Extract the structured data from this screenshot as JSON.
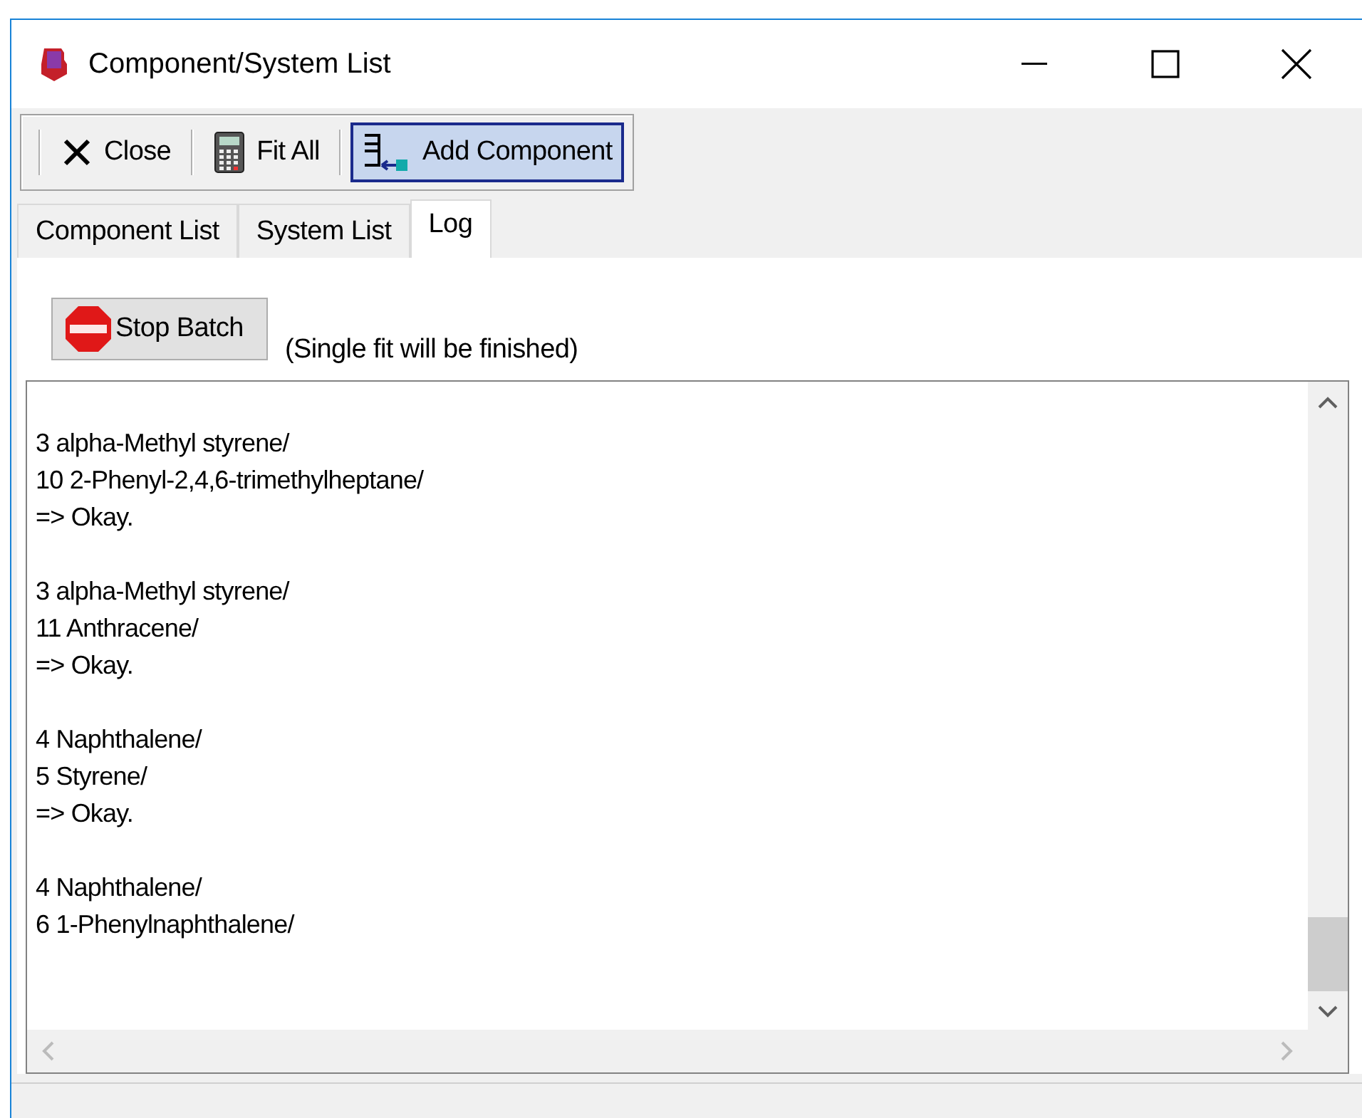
{
  "window": {
    "title": "Component/System List"
  },
  "toolbar": [
    {
      "kind": "close",
      "label": "Close",
      "pressed": false
    },
    {
      "kind": "calculator",
      "label": "Fit All",
      "pressed": false
    },
    {
      "kind": "add",
      "label": "Add Component",
      "pressed": true
    }
  ],
  "tabs": [
    {
      "label": "Component List",
      "selected": false
    },
    {
      "label": "System List",
      "selected": false
    },
    {
      "label": "Log",
      "selected": true
    }
  ],
  "stop_button": {
    "label": "Stop Batch"
  },
  "note": "(Single fit will be finished)",
  "log": [
    [
      "3 alpha-Methyl styrene/",
      "10 2-Phenyl-2,4,6-trimethylheptane/",
      "=> Okay."
    ],
    [
      "3 alpha-Methyl styrene/",
      "11 Anthracene/",
      "=> Okay."
    ],
    [
      "4 Naphthalene/",
      "5 Styrene/",
      "=> Okay."
    ],
    [
      "4 Naphthalene/",
      "6 1-Phenylnaphthalene/"
    ]
  ]
}
